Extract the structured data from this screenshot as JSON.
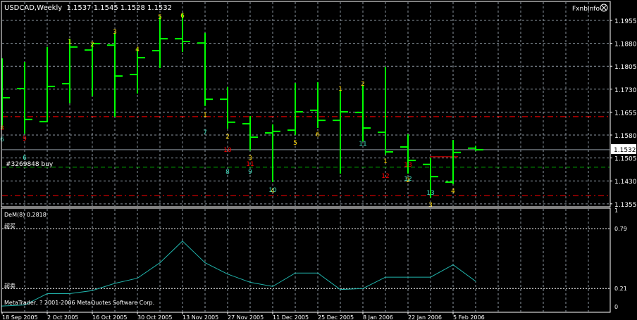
{
  "header": {
    "symbol_info": "USDCAD,Weekly  1.1537 1.1545 1.1528 1.1532",
    "brand": "FxnbInfo",
    "brand_icon": "smiley-frown-icon"
  },
  "colors": {
    "background": "#000000",
    "bars": "#00ff00",
    "grid": "#8c96a0",
    "text": "#ffffff",
    "resistance_line": "#ff0000",
    "order_line": "#00c000",
    "price_line": "#8c96a0",
    "indicator": "#20b2aa",
    "label_yellow": "#ffd700",
    "label_cyan": "#40e0c0",
    "label_red": "#ff0000"
  },
  "order_label": "#3269848 buy",
  "current_price": "1.1532",
  "footer": {
    "copyright": "MetaTrader, ? 2001-2006 MetaQuotes Software Corp."
  },
  "chart_data": [
    {
      "type": "ohlc",
      "title": "USDCAD,Weekly",
      "y_ticks": [
        "1.1955",
        "1.1880",
        "1.1805",
        "1.1730",
        "1.1655",
        "1.1580",
        "1.1505",
        "1.1430",
        "1.1355"
      ],
      "ylim": [
        1.134,
        1.2015
      ],
      "x_tick_labels": [
        "18 Sep 2005",
        "2 Oct 2005",
        "16 Oct 2005",
        "30 Oct 2005",
        "13 Nov 2005",
        "27 Nov 2005",
        "11 Dec 2005",
        "25 Dec 2005",
        "8 Jan 2006",
        "22 Jan 2006",
        "5 Feb 2006"
      ],
      "grid": true,
      "bars": [
        {
          "o": null,
          "h": 1.1831,
          "l": 1.1601,
          "c": 1.1702
        },
        {
          "o": 1.1732,
          "h": 1.1819,
          "l": 1.1585,
          "c": 1.1631
        },
        {
          "o": 1.1624,
          "h": 1.1868,
          "l": 1.1622,
          "c": 1.1739
        },
        {
          "o": 1.1748,
          "h": 1.1895,
          "l": 1.1684,
          "c": 1.1868
        },
        {
          "o": 1.1858,
          "h": 1.1879,
          "l": 1.1707,
          "c": 1.1879
        },
        {
          "o": 1.1874,
          "h": 1.1914,
          "l": 1.164,
          "c": 1.1773
        },
        {
          "o": 1.1778,
          "h": 1.1863,
          "l": 1.1716,
          "c": 1.1833
        },
        {
          "o": 1.1856,
          "h": 1.1967,
          "l": 1.1799,
          "c": 1.1895
        },
        {
          "o": 1.1895,
          "h": 1.1978,
          "l": 1.1852,
          "c": 1.1886
        },
        {
          "o": 1.1881,
          "h": 1.1914,
          "l": 1.1675,
          "c": 1.1697
        },
        {
          "o": 1.1697,
          "h": 1.1737,
          "l": 1.1601,
          "c": 1.1622
        },
        {
          "o": 1.1617,
          "h": 1.1642,
          "l": 1.153,
          "c": 1.1573
        },
        {
          "o": 1.1587,
          "h": 1.1615,
          "l": 1.1426,
          "c": 1.1592
        },
        {
          "o": 1.1596,
          "h": 1.175,
          "l": 1.158,
          "c": 1.1656
        },
        {
          "o": 1.1661,
          "h": 1.1753,
          "l": 1.1603,
          "c": 1.1628
        },
        {
          "o": 1.1628,
          "h": 1.1725,
          "l": 1.1454,
          "c": 1.1656
        },
        {
          "o": 1.1654,
          "h": 1.1743,
          "l": 1.1559,
          "c": 1.1603
        },
        {
          "o": 1.1589,
          "h": 1.1803,
          "l": 1.1516,
          "c": 1.1525
        },
        {
          "o": 1.1541,
          "h": 1.1582,
          "l": 1.1454,
          "c": 1.1497
        },
        {
          "o": 1.1484,
          "h": 1.1505,
          "l": 1.1375,
          "c": 1.1444
        },
        {
          "o": 1.1426,
          "h": 1.1564,
          "l": 1.1419,
          "c": 1.1523
        },
        {
          "o": 1.1537,
          "h": 1.1545,
          "l": 1.1528,
          "c": 1.1532
        }
      ],
      "hlines": [
        {
          "price": 1.164,
          "style": "dash-dot",
          "color": "#ff0000"
        },
        {
          "price": 1.1382,
          "style": "dash-dot",
          "color": "#ff0000"
        },
        {
          "price": 1.1475,
          "style": "dashed",
          "color": "#00c000"
        },
        {
          "price": 1.1532,
          "style": "solid",
          "color": "#8c96a0"
        }
      ],
      "segment": {
        "price": 1.1509,
        "from_bar": 19,
        "to_bar": 20,
        "color": "#ff0000"
      },
      "annotations": [
        {
          "bar": 3,
          "price": 1.1888,
          "text": "1",
          "color": "yellow"
        },
        {
          "bar": 4,
          "price": 1.1879,
          "text": "2",
          "color": "yellow"
        },
        {
          "bar": 5,
          "price": 1.1921,
          "text": "3",
          "color": "yellow"
        },
        {
          "bar": 6,
          "price": 1.1863,
          "text": "4",
          "color": "yellow"
        },
        {
          "bar": 7,
          "price": 1.1969,
          "text": "5",
          "color": "yellow"
        },
        {
          "bar": 8,
          "price": 1.1973,
          "text": "6",
          "color": "yellow"
        },
        {
          "bar": 9,
          "price": 1.1649,
          "text": "1",
          "color": "yellow"
        },
        {
          "bar": 10,
          "price": 1.1578,
          "text": "2",
          "color": "yellow"
        },
        {
          "bar": 11,
          "price": 1.1507,
          "text": "3",
          "color": "yellow"
        },
        {
          "bar": 12,
          "price": 1.1401,
          "text": "4",
          "color": "yellow"
        },
        {
          "bar": 13,
          "price": 1.1557,
          "text": "5",
          "color": "yellow"
        },
        {
          "bar": 14,
          "price": 1.1585,
          "text": "6",
          "color": "yellow"
        },
        {
          "bar": 15,
          "price": 1.1734,
          "text": "1",
          "color": "yellow"
        },
        {
          "bar": 16,
          "price": 1.175,
          "text": "2",
          "color": "yellow"
        },
        {
          "bar": 17,
          "price": 1.1497,
          "text": "1",
          "color": "yellow"
        },
        {
          "bar": 18,
          "price": 1.1435,
          "text": "2",
          "color": "yellow"
        },
        {
          "bar": 19,
          "price": 1.1355,
          "text": "3",
          "color": "yellow"
        },
        {
          "bar": 20,
          "price": 1.14,
          "text": "4",
          "color": "yellow"
        },
        {
          "bar": 0,
          "price": 1.1569,
          "text": "6",
          "color": "cyan"
        },
        {
          "bar": 1,
          "price": 1.1509,
          "text": "6",
          "color": "cyan"
        },
        {
          "bar": 9,
          "price": 1.1592,
          "text": "7",
          "color": "cyan"
        },
        {
          "bar": 10,
          "price": 1.1463,
          "text": "8",
          "color": "cyan"
        },
        {
          "bar": 11,
          "price": 1.1463,
          "text": "9",
          "color": "cyan"
        },
        {
          "bar": 12,
          "price": 1.1403,
          "text": "10",
          "color": "cyan"
        },
        {
          "bar": 16,
          "price": 1.1555,
          "text": "11",
          "color": "cyan"
        },
        {
          "bar": 18,
          "price": 1.144,
          "text": "12",
          "color": "cyan"
        },
        {
          "bar": 19,
          "price": 1.1394,
          "text": "13",
          "color": "cyan"
        },
        {
          "bar": 0,
          "price": 1.1605,
          "text": "8",
          "color": "red"
        },
        {
          "bar": 1,
          "price": 1.1571,
          "text": "9",
          "color": "red"
        },
        {
          "bar": 10,
          "price": 1.1534,
          "text": "10",
          "color": "red"
        },
        {
          "bar": 11,
          "price": 1.1488,
          "text": "11",
          "color": "red"
        },
        {
          "bar": 17,
          "price": 1.1449,
          "text": "12",
          "color": "red"
        },
        {
          "bar": 18,
          "price": 1.1486,
          "text": "13",
          "color": "red"
        }
      ]
    },
    {
      "type": "line",
      "title": "DeM(8) 0.2818",
      "ylim": [
        0,
        1
      ],
      "y_ticks": [
        "1",
        "0.79",
        "0.21",
        "0"
      ],
      "levels": [
        {
          "value": 0.79,
          "label": "超买"
        },
        {
          "value": 0.21,
          "label": "超卖"
        }
      ],
      "values": [
        0.04,
        0.05,
        0.16,
        0.16,
        0.19,
        0.26,
        0.31,
        0.46,
        0.67,
        0.46,
        0.35,
        0.27,
        0.23,
        0.36,
        0.36,
        0.2,
        0.21,
        0.32,
        0.32,
        0.32,
        0.44,
        0.28
      ]
    }
  ]
}
